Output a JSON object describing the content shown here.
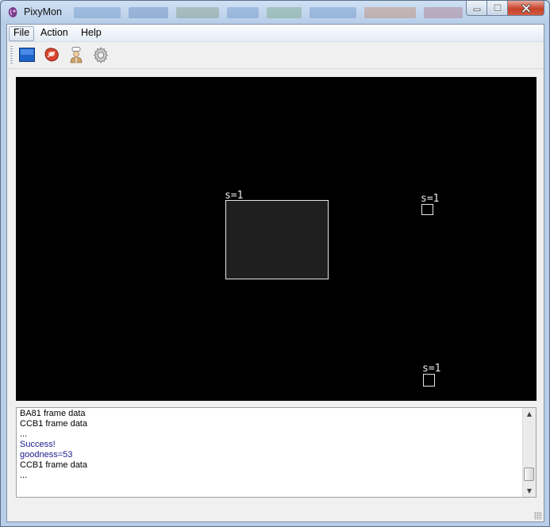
{
  "window": {
    "title": "PixyMon"
  },
  "menu": {
    "file": "File",
    "action": "Action",
    "help": "Help"
  },
  "toolbar": {
    "tools": [
      {
        "icon": "video-window-icon"
      },
      {
        "icon": "raw-frame-icon"
      },
      {
        "icon": "cooked-person-icon"
      },
      {
        "icon": "gear-icon"
      }
    ]
  },
  "video": {
    "blobs": [
      {
        "label": "s=1"
      },
      {
        "label": "s=1"
      },
      {
        "label": "s=1"
      }
    ]
  },
  "console": {
    "lines": [
      {
        "text": "BA81 frame data",
        "style": "normal"
      },
      {
        "text": "CCB1 frame data",
        "style": "normal"
      },
      {
        "text": "...",
        "style": "normal"
      },
      {
        "text": "Success!",
        "style": "blue"
      },
      {
        "text": "goodness=53",
        "style": "blue"
      },
      {
        "text": "CCB1 frame data",
        "style": "normal"
      },
      {
        "text": "...",
        "style": "normal"
      }
    ]
  },
  "colors": {
    "title_bar": "#cfe0f3",
    "close_button": "#c8432b",
    "video_background": "#000000",
    "blob_outline": "#e6e6e6",
    "console_message_blue": "#1a1a8c"
  }
}
